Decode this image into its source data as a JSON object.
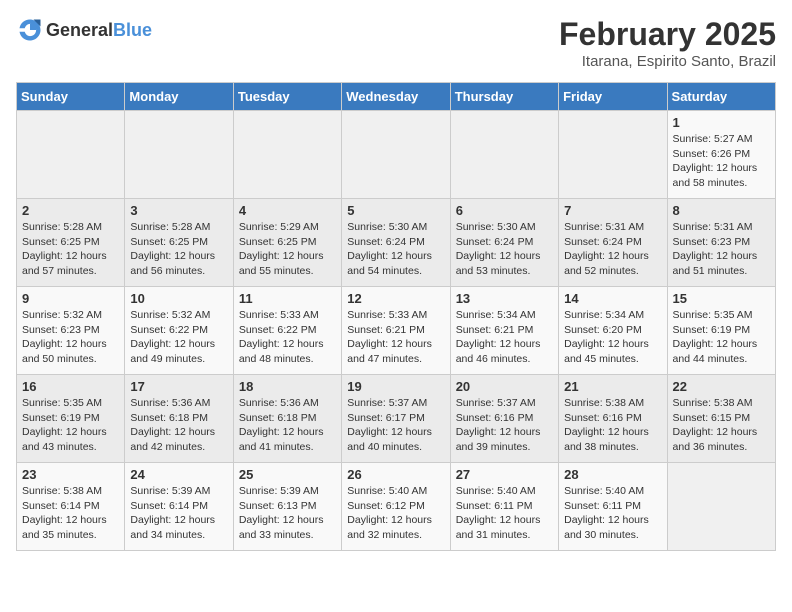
{
  "header": {
    "logo_general": "General",
    "logo_blue": "Blue",
    "title": "February 2025",
    "subtitle": "Itarana, Espirito Santo, Brazil"
  },
  "days_of_week": [
    "Sunday",
    "Monday",
    "Tuesday",
    "Wednesday",
    "Thursday",
    "Friday",
    "Saturday"
  ],
  "weeks": [
    [
      {
        "day": "",
        "info": ""
      },
      {
        "day": "",
        "info": ""
      },
      {
        "day": "",
        "info": ""
      },
      {
        "day": "",
        "info": ""
      },
      {
        "day": "",
        "info": ""
      },
      {
        "day": "",
        "info": ""
      },
      {
        "day": "1",
        "info": "Sunrise: 5:27 AM\nSunset: 6:26 PM\nDaylight: 12 hours and 58 minutes."
      }
    ],
    [
      {
        "day": "2",
        "info": "Sunrise: 5:28 AM\nSunset: 6:25 PM\nDaylight: 12 hours and 57 minutes."
      },
      {
        "day": "3",
        "info": "Sunrise: 5:28 AM\nSunset: 6:25 PM\nDaylight: 12 hours and 56 minutes."
      },
      {
        "day": "4",
        "info": "Sunrise: 5:29 AM\nSunset: 6:25 PM\nDaylight: 12 hours and 55 minutes."
      },
      {
        "day": "5",
        "info": "Sunrise: 5:30 AM\nSunset: 6:24 PM\nDaylight: 12 hours and 54 minutes."
      },
      {
        "day": "6",
        "info": "Sunrise: 5:30 AM\nSunset: 6:24 PM\nDaylight: 12 hours and 53 minutes."
      },
      {
        "day": "7",
        "info": "Sunrise: 5:31 AM\nSunset: 6:24 PM\nDaylight: 12 hours and 52 minutes."
      },
      {
        "day": "8",
        "info": "Sunrise: 5:31 AM\nSunset: 6:23 PM\nDaylight: 12 hours and 51 minutes."
      }
    ],
    [
      {
        "day": "9",
        "info": "Sunrise: 5:32 AM\nSunset: 6:23 PM\nDaylight: 12 hours and 50 minutes."
      },
      {
        "day": "10",
        "info": "Sunrise: 5:32 AM\nSunset: 6:22 PM\nDaylight: 12 hours and 49 minutes."
      },
      {
        "day": "11",
        "info": "Sunrise: 5:33 AM\nSunset: 6:22 PM\nDaylight: 12 hours and 48 minutes."
      },
      {
        "day": "12",
        "info": "Sunrise: 5:33 AM\nSunset: 6:21 PM\nDaylight: 12 hours and 47 minutes."
      },
      {
        "day": "13",
        "info": "Sunrise: 5:34 AM\nSunset: 6:21 PM\nDaylight: 12 hours and 46 minutes."
      },
      {
        "day": "14",
        "info": "Sunrise: 5:34 AM\nSunset: 6:20 PM\nDaylight: 12 hours and 45 minutes."
      },
      {
        "day": "15",
        "info": "Sunrise: 5:35 AM\nSunset: 6:19 PM\nDaylight: 12 hours and 44 minutes."
      }
    ],
    [
      {
        "day": "16",
        "info": "Sunrise: 5:35 AM\nSunset: 6:19 PM\nDaylight: 12 hours and 43 minutes."
      },
      {
        "day": "17",
        "info": "Sunrise: 5:36 AM\nSunset: 6:18 PM\nDaylight: 12 hours and 42 minutes."
      },
      {
        "day": "18",
        "info": "Sunrise: 5:36 AM\nSunset: 6:18 PM\nDaylight: 12 hours and 41 minutes."
      },
      {
        "day": "19",
        "info": "Sunrise: 5:37 AM\nSunset: 6:17 PM\nDaylight: 12 hours and 40 minutes."
      },
      {
        "day": "20",
        "info": "Sunrise: 5:37 AM\nSunset: 6:16 PM\nDaylight: 12 hours and 39 minutes."
      },
      {
        "day": "21",
        "info": "Sunrise: 5:38 AM\nSunset: 6:16 PM\nDaylight: 12 hours and 38 minutes."
      },
      {
        "day": "22",
        "info": "Sunrise: 5:38 AM\nSunset: 6:15 PM\nDaylight: 12 hours and 36 minutes."
      }
    ],
    [
      {
        "day": "23",
        "info": "Sunrise: 5:38 AM\nSunset: 6:14 PM\nDaylight: 12 hours and 35 minutes."
      },
      {
        "day": "24",
        "info": "Sunrise: 5:39 AM\nSunset: 6:14 PM\nDaylight: 12 hours and 34 minutes."
      },
      {
        "day": "25",
        "info": "Sunrise: 5:39 AM\nSunset: 6:13 PM\nDaylight: 12 hours and 33 minutes."
      },
      {
        "day": "26",
        "info": "Sunrise: 5:40 AM\nSunset: 6:12 PM\nDaylight: 12 hours and 32 minutes."
      },
      {
        "day": "27",
        "info": "Sunrise: 5:40 AM\nSunset: 6:11 PM\nDaylight: 12 hours and 31 minutes."
      },
      {
        "day": "28",
        "info": "Sunrise: 5:40 AM\nSunset: 6:11 PM\nDaylight: 12 hours and 30 minutes."
      },
      {
        "day": "",
        "info": ""
      }
    ]
  ]
}
